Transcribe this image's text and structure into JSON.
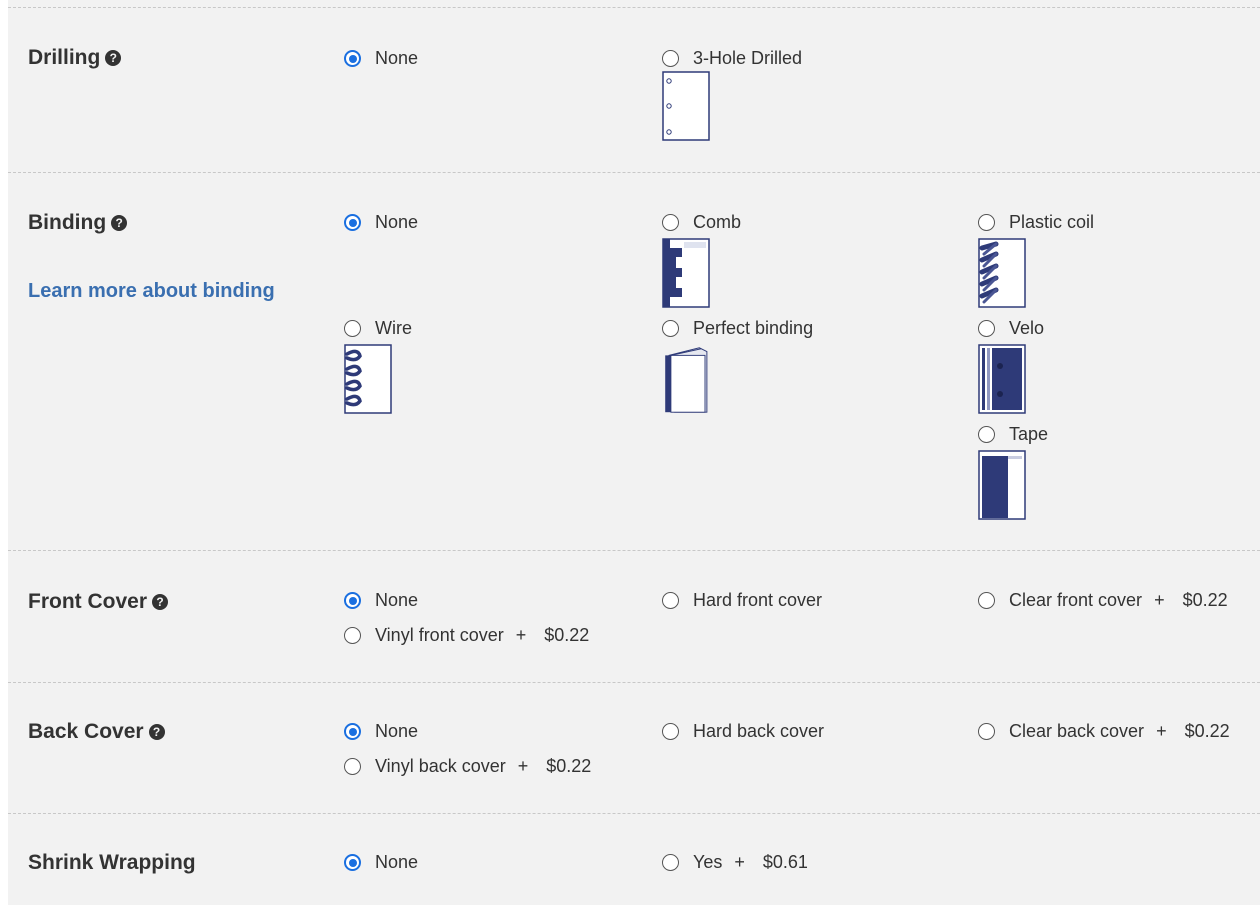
{
  "sections": {
    "drilling": {
      "label": "Drilling",
      "options": [
        {
          "label": "None",
          "selected": true
        },
        {
          "label": "3-Hole Drilled",
          "selected": false
        }
      ]
    },
    "binding": {
      "label": "Binding",
      "learn_more": "Learn more about binding",
      "options": [
        {
          "label": "None",
          "selected": true
        },
        {
          "label": "Comb",
          "selected": false
        },
        {
          "label": "Plastic coil",
          "selected": false
        },
        {
          "label": "Wire",
          "selected": false
        },
        {
          "label": "Perfect binding",
          "selected": false
        },
        {
          "label": "Velo",
          "selected": false
        },
        {
          "label": "Tape",
          "selected": false
        }
      ]
    },
    "front_cover": {
      "label": "Front Cover",
      "options": [
        {
          "label": "None",
          "selected": true
        },
        {
          "label": "Hard front cover",
          "selected": false
        },
        {
          "label": "Clear front cover",
          "selected": false,
          "price": "$0.22"
        },
        {
          "label": "Vinyl front cover",
          "selected": false,
          "price": "$0.22"
        }
      ]
    },
    "back_cover": {
      "label": "Back Cover",
      "options": [
        {
          "label": "None",
          "selected": true
        },
        {
          "label": "Hard back cover",
          "selected": false
        },
        {
          "label": "Clear back cover",
          "selected": false,
          "price": "$0.22"
        },
        {
          "label": "Vinyl back cover",
          "selected": false,
          "price": "$0.22"
        }
      ]
    },
    "shrink_wrapping": {
      "label": "Shrink Wrapping",
      "options": [
        {
          "label": "None",
          "selected": true
        },
        {
          "label": "Yes",
          "selected": false,
          "price": "$0.61"
        }
      ]
    }
  },
  "common": {
    "help_glyph": "?",
    "plus": "+"
  },
  "icons": {
    "help": "question-circle-icon"
  },
  "colors": {
    "accent": "#1a6fe0",
    "link": "#3a6fb0",
    "thumb_navy": "#2e3a78",
    "panel_bg": "#f2f2f2"
  }
}
